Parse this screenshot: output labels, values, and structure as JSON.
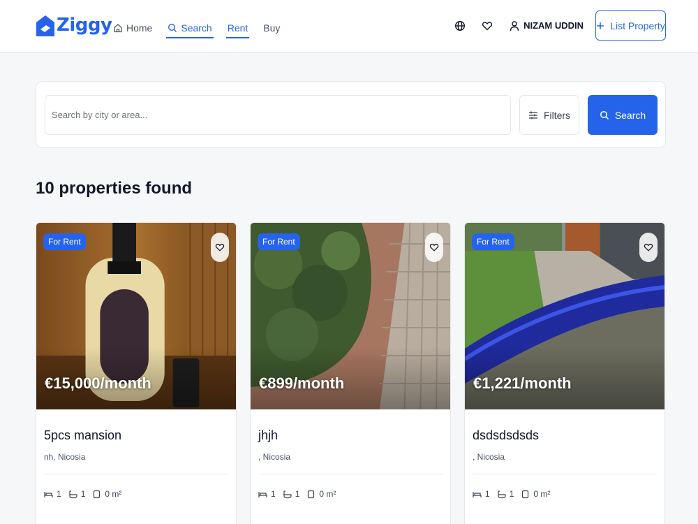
{
  "brand": {
    "name": "Ziggy",
    "color": "#2563eb"
  },
  "nav": [
    {
      "label": "Home",
      "icon": "home-icon",
      "active": false
    },
    {
      "label": "Search",
      "icon": "search-icon",
      "active": true
    },
    {
      "label": "Rent",
      "icon": "",
      "active": true
    },
    {
      "label": "Buy",
      "icon": "",
      "active": false
    }
  ],
  "header": {
    "language_icon": "globe-icon",
    "favorites_icon": "heart-icon",
    "user_icon": "user-icon",
    "user_name": "NIZAM UDDIN",
    "list_property_label": "List Property"
  },
  "search": {
    "placeholder": "Search by city or area...",
    "value": "",
    "filters_label": "Filters",
    "search_label": "Search"
  },
  "results": {
    "title": "10 properties found"
  },
  "listings": [
    {
      "badge": "For Rent",
      "price": "€15,000/month",
      "title": "5pcs mansion",
      "location": "nh, Nicosia",
      "bedrooms": "1",
      "bathrooms": "1",
      "area": "0 m²"
    },
    {
      "badge": "For Rent",
      "price": "€899/month",
      "title": "jhjh",
      "location": ", Nicosia",
      "bedrooms": "1",
      "bathrooms": "1",
      "area": "0 m²"
    },
    {
      "badge": "For Rent",
      "price": "€1,221/month",
      "title": "dsdsdsdsds",
      "location": ", Nicosia",
      "bedrooms": "1",
      "bathrooms": "1",
      "area": "0 m²"
    }
  ],
  "colors": {
    "accent": "#2563eb",
    "background": "#f6f7f9",
    "text": "#111827",
    "muted": "#4b5563"
  }
}
